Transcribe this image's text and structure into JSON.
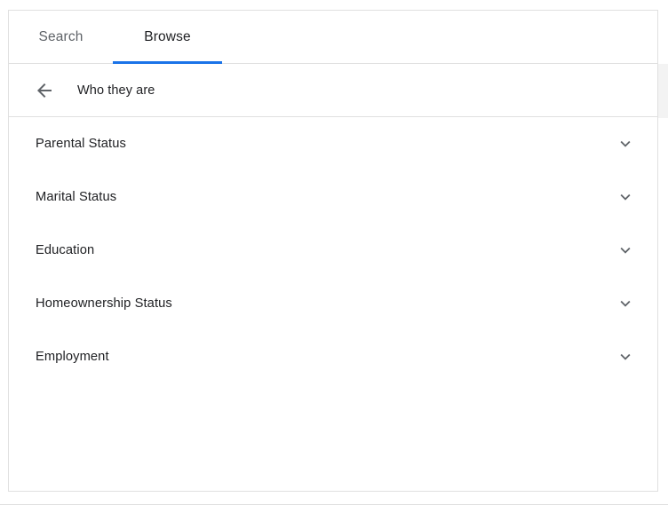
{
  "tabs": [
    {
      "id": "search",
      "label": "Search",
      "active": false
    },
    {
      "id": "browse",
      "label": "Browse",
      "active": true
    }
  ],
  "subheader": {
    "back_icon": "arrow-left-icon",
    "title": "Who they are"
  },
  "list": {
    "expand_icon": "chevron-down-icon",
    "items": [
      {
        "label": "Parental Status"
      },
      {
        "label": "Marital Status"
      },
      {
        "label": "Education"
      },
      {
        "label": "Homeownership Status"
      },
      {
        "label": "Employment"
      }
    ]
  },
  "colors": {
    "accent": "#1a73e8",
    "text_primary": "#202124",
    "text_secondary": "#5f6368",
    "border": "#e0e0e0",
    "icon": "#5f6368",
    "scrollbar_thumb": "#f3f3f3"
  }
}
